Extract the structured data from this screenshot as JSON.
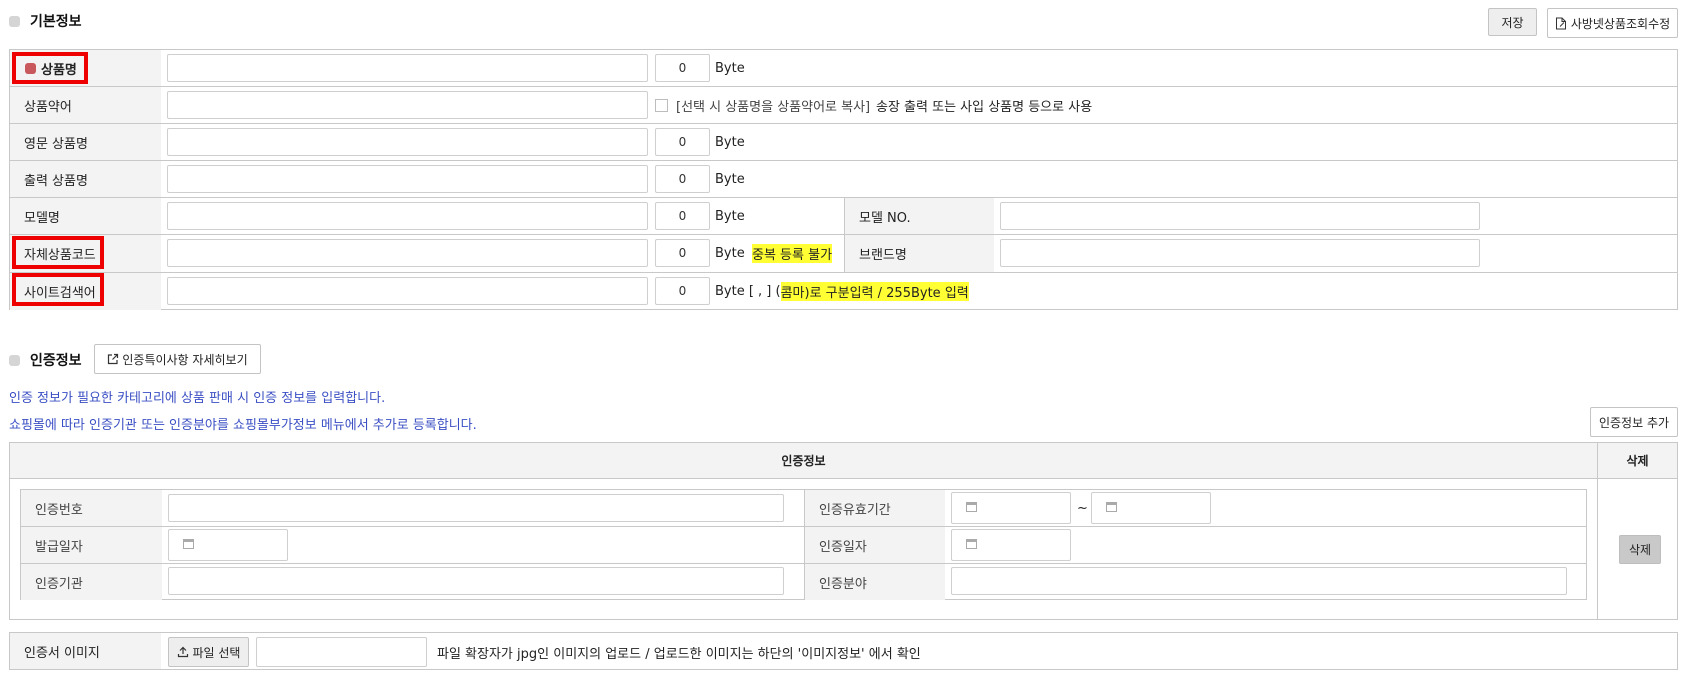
{
  "basic": {
    "title": "기본정보",
    "save_label": "저장",
    "edit_label": "사방넷상품조회수정",
    "byte_unit": "Byte",
    "byte_default": "0",
    "rows": {
      "product_name": "상품명",
      "short_name": "상품약어",
      "short_copy": "[선택 시 상품명을 상품약어로 복사]",
      "short_note": "송장 출력 또는 사입 상품명 등으로 사용",
      "english_name": "영문 상품명",
      "print_name": "출력 상품명",
      "model_name": "모델명",
      "model_no": "모델 NO.",
      "own_code": "자체상품코드",
      "dup_warning": "중복 등록 불가",
      "brand": "브랜드명",
      "keyword": "사이트검색어",
      "keyword_prefix": "Byte [ , ] (",
      "keyword_highlight": "콤마)로 구분입력 / 255Byte 입력"
    }
  },
  "cert": {
    "title": "인증정보",
    "detail_label": "인증특이사항 자세히보기",
    "info_line1": "인증 정보가 필요한 카테고리에 상품 판매 시 인증 정보를 입력합니다.",
    "info_line2": "쇼핑몰에 따라 인증기관 또는 인증분야를 쇼핑몰부가정보 메뉴에서 추가로 등록합니다.",
    "add_label": "인증정보 추가",
    "table_header": "인증정보",
    "delete_header": "삭제",
    "delete_label": "삭제",
    "fields": {
      "cert_no": "인증번호",
      "valid_period": "인증유효기간",
      "tilde": "~",
      "issue_date": "발급일자",
      "cert_date": "인증일자",
      "agency": "인증기관",
      "field": "인증분야"
    },
    "image_label": "인증서 이미지",
    "file_label": "파일 선택",
    "file_note": "파일 확장자가 jpg인 이미지의 업로드 / 업로드한 이미지는 하단의 '이미지정보' 에서 확인"
  }
}
